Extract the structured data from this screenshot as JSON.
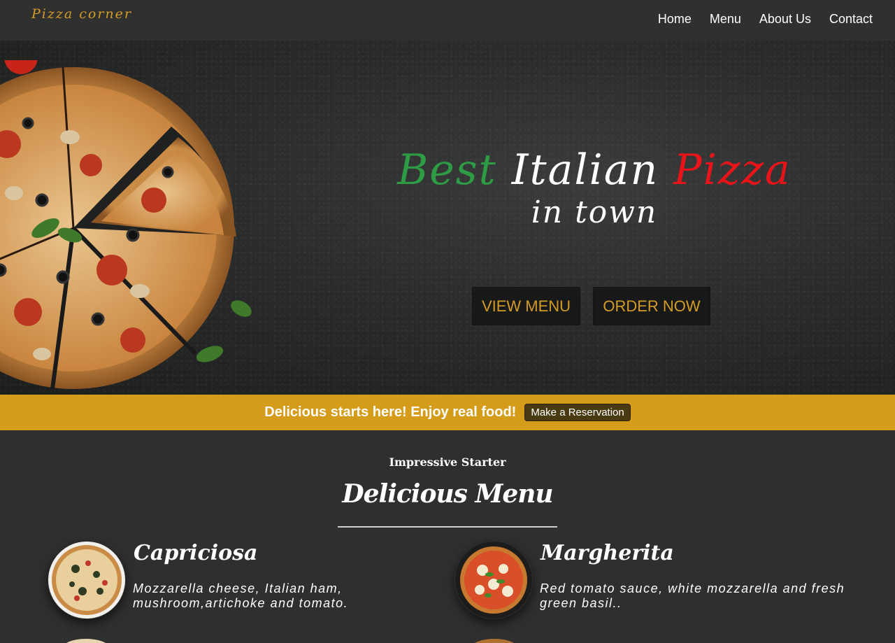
{
  "brand": {
    "logo_text": "Pizza corner",
    "accent_color": "#d49c24"
  },
  "nav": {
    "links": [
      "Home",
      "Menu",
      "About Us",
      "Contact"
    ]
  },
  "hero": {
    "headline_word1": "Best",
    "headline_word2": "Italian",
    "headline_word3": "Pizza",
    "headline_line2": "in town",
    "colors": {
      "best": "#2e9c44",
      "italian": "#ffffff",
      "pizza": "#e8141a"
    },
    "buttons": {
      "view_menu": "VIEW MENU",
      "order_now": "ORDER NOW"
    }
  },
  "promo": {
    "text": "Delicious starts here! Enjoy real food!",
    "button": "Make a Reservation",
    "bg_color": "#d59c1a"
  },
  "menu": {
    "kicker": "Impressive Starter",
    "title": "Delicious Menu",
    "items": [
      {
        "name": "Capriciosa",
        "description": "Mozzarella cheese, Italian ham, mushroom,artichoke and tomato."
      },
      {
        "name": "Margherita",
        "description": "Red tomato sauce, white mozzarella and fresh green basil.."
      }
    ]
  }
}
